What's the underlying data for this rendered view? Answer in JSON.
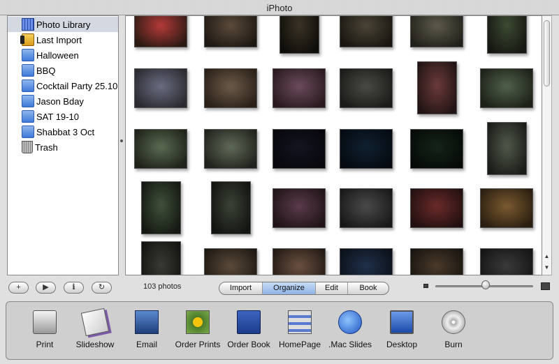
{
  "window": {
    "title": "iPhoto"
  },
  "sidebar": {
    "items": [
      {
        "label": "Photo Library",
        "icon": "library-icon",
        "selected": true
      },
      {
        "label": "Last Import",
        "icon": "film-roll-icon"
      },
      {
        "label": "Halloween",
        "icon": "album-icon"
      },
      {
        "label": "BBQ",
        "icon": "album-icon"
      },
      {
        "label": "Cocktail Party 25.10",
        "icon": "album-icon"
      },
      {
        "label": "Jason Bday",
        "icon": "album-icon"
      },
      {
        "label": "SAT 19-10",
        "icon": "album-icon"
      },
      {
        "label": "Shabbat 3 Oct",
        "icon": "album-icon"
      },
      {
        "label": "Trash",
        "icon": "trash-icon"
      }
    ]
  },
  "toolbar": {
    "buttons": [
      {
        "label": "+",
        "icon": "add-icon"
      },
      {
        "label": "▶",
        "icon": "play-icon"
      },
      {
        "label": "ℹ",
        "icon": "info-icon"
      },
      {
        "label": "↻",
        "icon": "rotate-icon"
      }
    ],
    "count": "103 photos",
    "modes": [
      {
        "label": "Import"
      },
      {
        "label": "Organize",
        "active": true
      },
      {
        "label": "Edit"
      },
      {
        "label": "Book"
      }
    ]
  },
  "tools": [
    {
      "label": "Print",
      "icon": "printer-icon"
    },
    {
      "label": "Slideshow",
      "icon": "slideshow-icon"
    },
    {
      "label": "Email",
      "icon": "email-icon"
    },
    {
      "label": "Order Prints",
      "icon": "order-prints-icon"
    },
    {
      "label": "Order Book",
      "icon": "order-book-icon"
    },
    {
      "label": "HomePage",
      "icon": "homepage-icon"
    },
    {
      "label": ".Mac Slides",
      "icon": "mac-slides-icon"
    },
    {
      "label": "Desktop",
      "icon": "desktop-icon"
    },
    {
      "label": "Burn",
      "icon": "burn-icon"
    }
  ],
  "photos": [
    [
      "#b33a3a",
      "#2a1a12"
    ],
    [
      "#5a4a3a",
      "#1e1813"
    ],
    [
      "#3a3325",
      "#0f0d0a"
    ],
    [
      "#4a4436",
      "#191611"
    ],
    [
      "#5b5a4a",
      "#22201a"
    ],
    [
      "#3d4a32",
      "#151712"
    ],
    [
      "#6a6c80",
      "#2a2a30"
    ],
    [
      "#6b5a48",
      "#2a2018"
    ],
    [
      "#6a4a5a",
      "#2a1a20"
    ],
    [
      "#4a4a44",
      "#1a1a18"
    ],
    [
      "#6a3a3a",
      "#221414"
    ],
    [
      "#50604a",
      "#1c2018"
    ],
    [
      "#5a6a52",
      "#1e2219"
    ],
    [
      "#606a58",
      "#20221c"
    ],
    [
      "#141420",
      "#07070c"
    ],
    [
      "#102030",
      "#050a10"
    ],
    [
      "#142418",
      "#060a07"
    ],
    [
      "#50584a",
      "#1a1c18"
    ],
    [
      "#40503a",
      "#141812"
    ],
    [
      "#3a4236",
      "#121410"
    ],
    [
      "#5a3a4a",
      "#201418"
    ],
    [
      "#4a4a4a",
      "#181818"
    ],
    [
      "#6a2a2a",
      "#221010"
    ],
    [
      "#7a5a30",
      "#2a1e10"
    ],
    [
      "#3a3a34",
      "#121210"
    ],
    [
      "#5a4a3a",
      "#1e1812"
    ],
    [
      "#6a5040",
      "#221a14"
    ],
    [
      "#20304a",
      "#0a1018"
    ],
    [
      "#4a3a2a",
      "#181410"
    ],
    [
      "#3a3a3a",
      "#141414"
    ]
  ]
}
